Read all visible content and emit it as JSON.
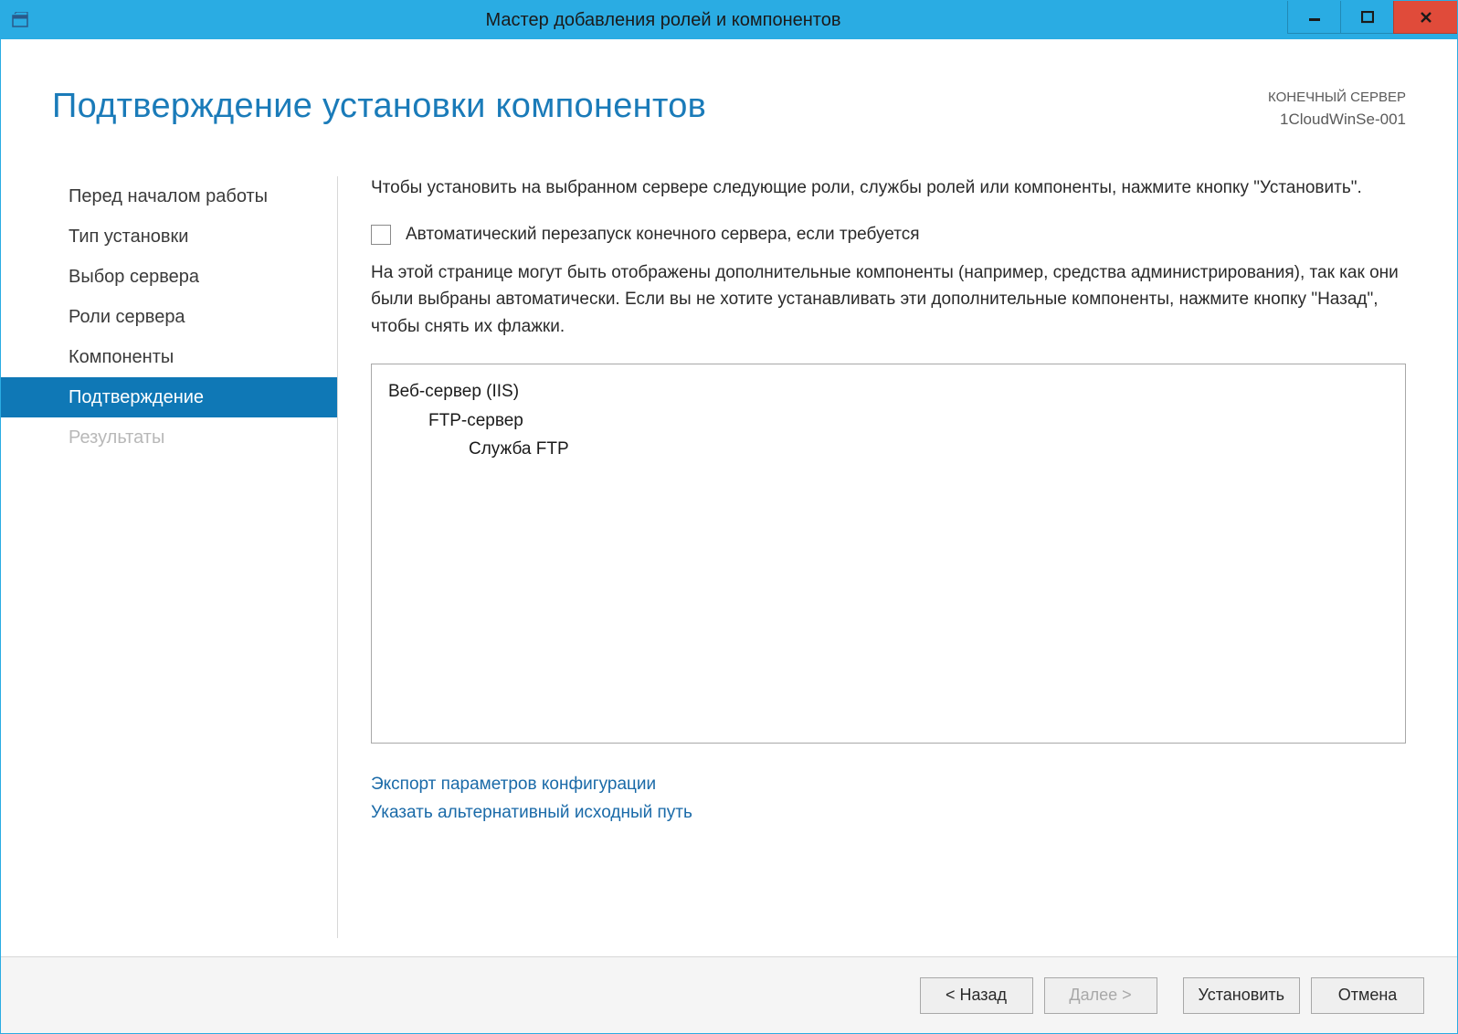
{
  "window": {
    "title": "Мастер добавления ролей и компонентов"
  },
  "header": {
    "page_title": "Подтверждение установки компонентов",
    "destination_label": "КОНЕЧНЫЙ СЕРВЕР",
    "destination_name": "1CloudWinSe-001"
  },
  "sidebar": {
    "items": [
      {
        "label": "Перед началом работы",
        "state": "normal"
      },
      {
        "label": "Тип установки",
        "state": "normal"
      },
      {
        "label": "Выбор сервера",
        "state": "normal"
      },
      {
        "label": "Роли сервера",
        "state": "normal"
      },
      {
        "label": "Компоненты",
        "state": "normal"
      },
      {
        "label": "Подтверждение",
        "state": "active"
      },
      {
        "label": "Результаты",
        "state": "disabled"
      }
    ]
  },
  "main": {
    "intro": "Чтобы установить на выбранном сервере следующие роли, службы ролей или компоненты, нажмите кнопку \"Установить\".",
    "checkbox_label": "Автоматический перезапуск конечного сервера, если требуется",
    "checkbox_checked": false,
    "info": "На этой странице могут быть отображены дополнительные компоненты (например, средства администрирования), так как они были выбраны автоматически. Если вы не хотите устанавливать эти дополнительные компоненты, нажмите кнопку \"Назад\", чтобы снять их флажки.",
    "tree": [
      {
        "level": 0,
        "label": "Веб-сервер (IIS)"
      },
      {
        "level": 1,
        "label": "FTP-сервер"
      },
      {
        "level": 2,
        "label": "Служба FTP"
      }
    ],
    "links": {
      "export": "Экспорт параметров конфигурации",
      "alt_path": "Указать альтернативный исходный путь"
    }
  },
  "footer": {
    "back": "< Назад",
    "next": "Далее >",
    "install": "Установить",
    "cancel": "Отмена"
  }
}
